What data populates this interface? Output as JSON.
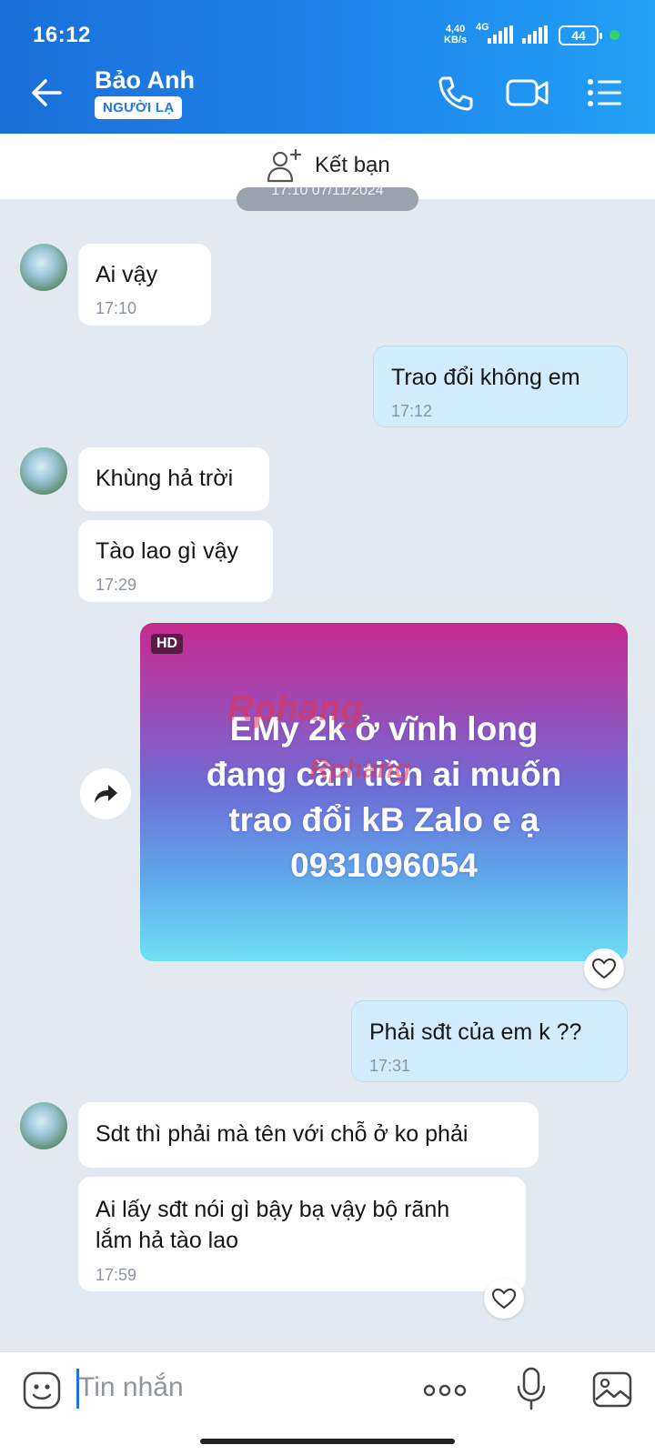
{
  "status_bar": {
    "time": "16:12",
    "speed_value": "4,40",
    "speed_unit": "KB/s",
    "network": "4G",
    "battery": "44"
  },
  "header": {
    "contact_name": "Bảo Anh",
    "badge": "NGƯỜI LẠ",
    "icons": [
      "back-arrow-icon",
      "phone-icon",
      "video-icon",
      "menu-list-icon"
    ]
  },
  "friend_bar": {
    "label": "Kết bạn",
    "icon": "add-person-icon"
  },
  "date_divider": "17:10 07/11/2024",
  "messages": [
    {
      "side": "them",
      "text": "Ai vậy",
      "time": "17:10"
    },
    {
      "side": "me",
      "text": "Trao đổi không em",
      "time": "17:12"
    },
    {
      "side": "them",
      "text": "Khùng hả trời",
      "time": ""
    },
    {
      "side": "them",
      "text": "Tào lao gì vậy",
      "time": "17:29"
    },
    {
      "side": "them",
      "type": "image",
      "hd_label": "HD",
      "caption_lines": [
        "EMy 2k ở vĩnh long",
        "đang cần tiền ai muốn",
        "trao đổi kB Zalo e ạ",
        "0931096054"
      ],
      "watermark": "Rphang"
    },
    {
      "side": "me",
      "text": "Phải sđt của em k ??",
      "time": "17:31"
    },
    {
      "side": "them",
      "text": "Sdt thì phải mà tên với chỗ ở ko phải",
      "time": ""
    },
    {
      "side": "them",
      "text_lines": [
        "Ai lấy sđt nói gì bậy bạ vậy bộ rãnh",
        "lắm hả tào lao"
      ],
      "time": "17:59"
    }
  ],
  "input_bar": {
    "placeholder": "Tin nhắn",
    "icons": [
      "emoji-icon",
      "more-dots-icon",
      "microphone-icon",
      "gallery-icon"
    ]
  },
  "colors": {
    "header_start": "#1a6fd8",
    "header_end": "#22a0f5",
    "chat_bg": "#e2e9f1",
    "my_bubble": "#d3ecfb",
    "their_bubble": "#ffffff"
  }
}
